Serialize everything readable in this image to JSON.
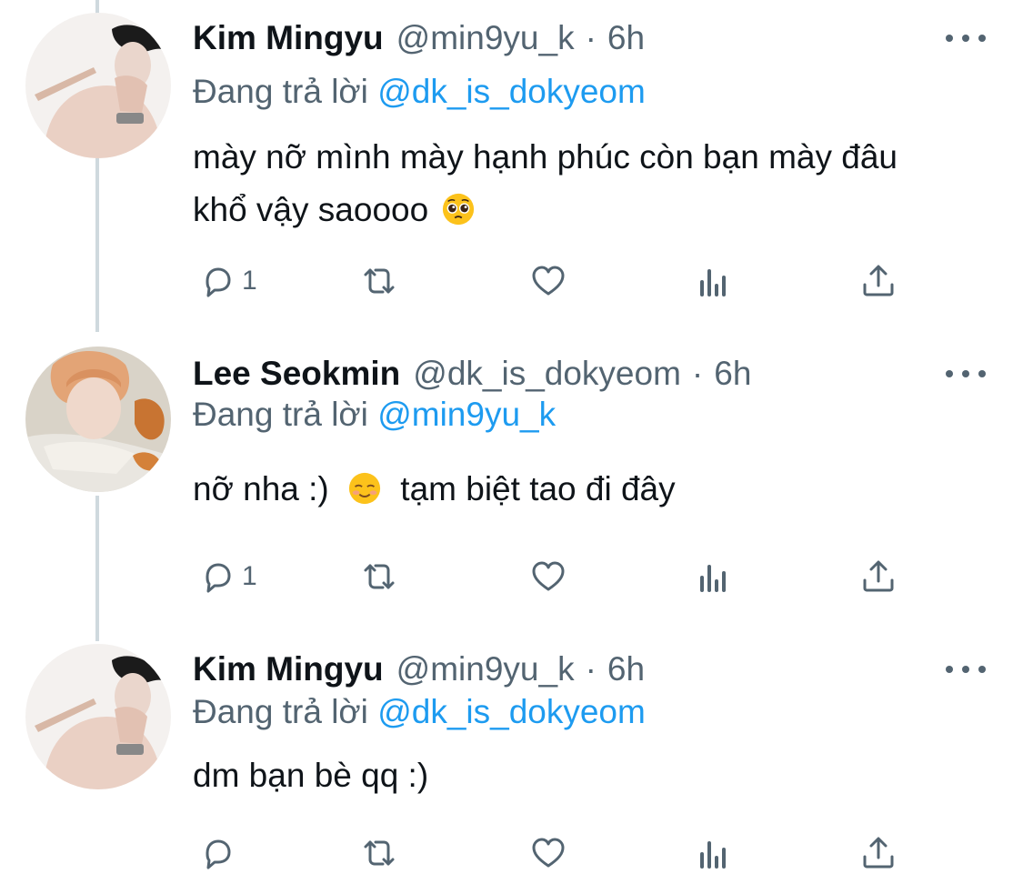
{
  "tweets": [
    {
      "name": "Kim Mingyu",
      "handle": "@min9yu_k",
      "separator": "·",
      "time": "6h",
      "replying_prefix": "Đang trả lời",
      "replying_to": "@dk_is_dokyeom",
      "text_line1": "mày nỡ mình mày hạnh phúc còn bạn mày đâu",
      "text_line2": "khổ vậy saoooo",
      "emoji": "pleading-face",
      "reply_count": "1"
    },
    {
      "name": "Lee Seokmin",
      "handle": "@dk_is_dokyeom",
      "separator": "·",
      "time": "6h",
      "replying_prefix": "Đang trả lời",
      "replying_to": "@min9yu_k",
      "text_before": "nỡ nha :)",
      "text_after": "tạm biệt tao đi đây",
      "emoji": "smiling-face",
      "reply_count": "1"
    },
    {
      "name": "Kim Mingyu",
      "handle": "@min9yu_k",
      "separator": "·",
      "time": "6h",
      "replying_prefix": "Đang trả lời",
      "replying_to": "@dk_is_dokyeom",
      "text": "dm bạn bè qq :)",
      "reply_count": ""
    }
  ],
  "colors": {
    "text": "#0f1419",
    "secondary": "#536471",
    "link": "#1d9bf0",
    "thread_line": "#cfd9de"
  },
  "icons": [
    "more-icon",
    "reply-icon",
    "retweet-icon",
    "like-icon",
    "analytics-icon",
    "share-icon"
  ]
}
